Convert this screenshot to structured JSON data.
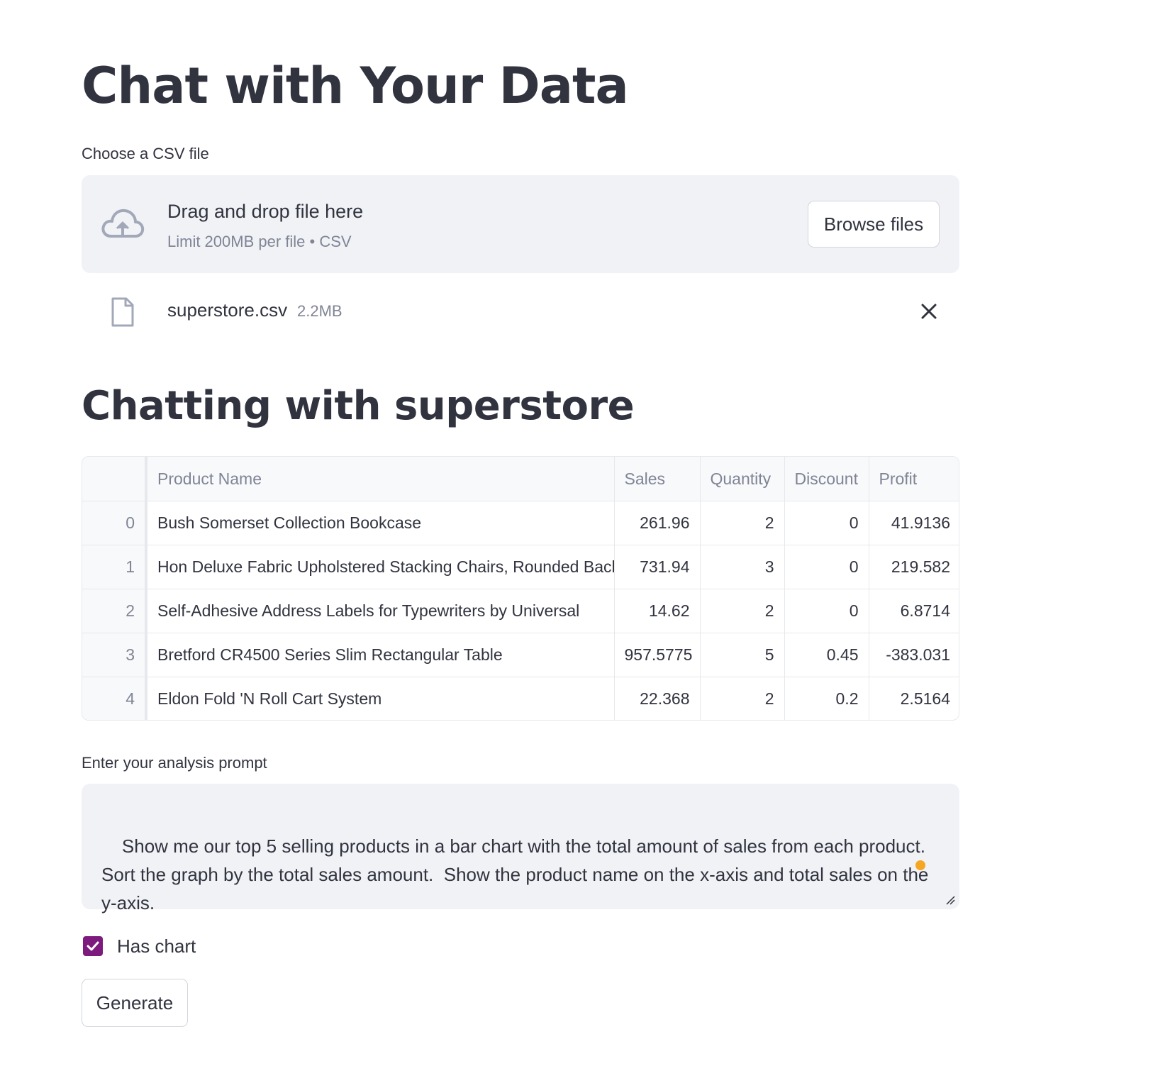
{
  "app": {
    "title": "Chat with Your Data"
  },
  "uploader": {
    "label": "Choose a CSV file",
    "drop_text": "Drag and drop file here",
    "limit_text": "Limit 200MB per file • CSV",
    "browse_label": "Browse files",
    "cloud_icon": "cloud-upload-icon"
  },
  "uploaded_file": {
    "name": "superstore.csv",
    "size": "2.2MB",
    "file_icon": "file-icon",
    "remove_icon": "close-icon"
  },
  "section": {
    "title": "Chatting with superstore"
  },
  "table": {
    "columns": [
      "",
      "Product Name",
      "Sales",
      "Quantity",
      "Discount",
      "Profit"
    ],
    "rows": [
      [
        "0",
        "Bush Somerset Collection Bookcase",
        "261.96",
        "2",
        "0",
        "41.9136"
      ],
      [
        "1",
        "Hon Deluxe Fabric Upholstered Stacking Chairs, Rounded Back",
        "731.94",
        "3",
        "0",
        "219.582"
      ],
      [
        "2",
        "Self-Adhesive Address Labels for Typewriters by Universal",
        "14.62",
        "2",
        "0",
        "6.8714"
      ],
      [
        "3",
        "Bretford CR4500 Series Slim Rectangular Table",
        "957.5775",
        "5",
        "0.45",
        "-383.031"
      ],
      [
        "4",
        "Eldon Fold 'N Roll Cart System",
        "22.368",
        "2",
        "0.2",
        "2.5164"
      ]
    ]
  },
  "prompt": {
    "label": "Enter your analysis prompt",
    "value": "Show me our top 5 selling products in a bar chart with the total amount of sales from each product.\nSort the graph by the total sales amount.  Show the product name on the x-axis and total sales on the\ny-axis."
  },
  "has_chart": {
    "label": "Has chart",
    "checked": true,
    "accent_color": "#7d1a7d"
  },
  "generate": {
    "label": "Generate"
  }
}
